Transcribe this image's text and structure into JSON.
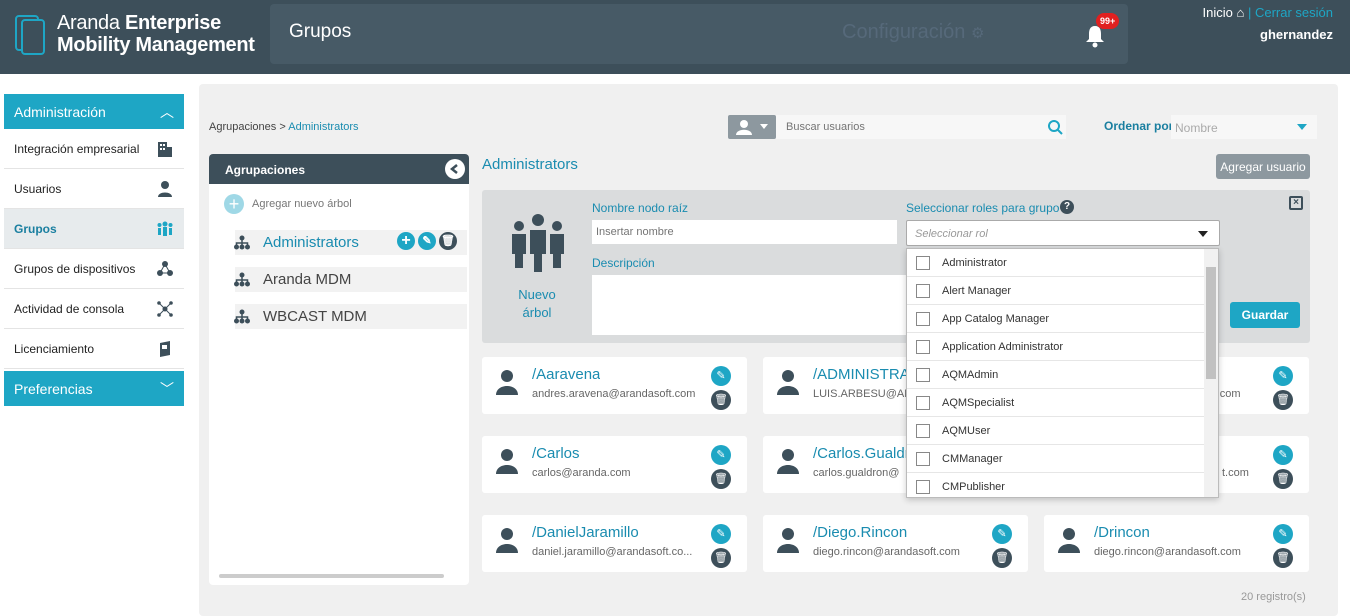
{
  "header": {
    "brand_line1_light": "Aranda",
    "brand_line1_bold": "Enterprise",
    "brand_line2": "Mobility Management",
    "page_title": "Grupos",
    "config_label": "Configuración",
    "notification_badge": "99+",
    "home_link": "Inicio",
    "separator": "|",
    "logout_link": "Cerrar sesión",
    "username": "ghernandez"
  },
  "sidebar": {
    "sections": [
      {
        "label": "Administración",
        "expanded": true
      },
      {
        "label": "Preferencias",
        "expanded": false
      }
    ],
    "items": [
      {
        "label": "Integración empresarial",
        "icon": "building-icon"
      },
      {
        "label": "Usuarios",
        "icon": "user-icon"
      },
      {
        "label": "Grupos",
        "icon": "group-icon",
        "active": true
      },
      {
        "label": "Grupos de dispositivos",
        "icon": "device-group-icon"
      },
      {
        "label": "Actividad de consola",
        "icon": "network-icon"
      },
      {
        "label": "Licenciamiento",
        "icon": "license-icon"
      }
    ]
  },
  "breadcrumb": {
    "root": "Agrupaciones",
    "sep": ">",
    "current": "Administrators"
  },
  "search": {
    "placeholder": "Buscar usuarios"
  },
  "order": {
    "label": "Ordenar por:",
    "value": "Nombre"
  },
  "tree": {
    "header": "Agrupaciones",
    "add_label": "Agregar nuevo árbol",
    "nodes": [
      "Administrators",
      "Aranda MDM",
      "WBCAST MDM"
    ]
  },
  "group": {
    "title": "Administrators",
    "add_user_label": "Agregar usuario"
  },
  "form": {
    "new_label": "Nuevo árbol",
    "name_label": "Nombre nodo raíz",
    "name_placeholder": "Insertar nombre",
    "desc_label": "Descripción",
    "roles_label": "Seleccionar roles para grupo",
    "roles_placeholder": "Seleccionar rol",
    "help": "?",
    "save_label": "Guardar"
  },
  "roles": [
    "Administrator",
    "Alert Manager",
    "App Catalog Manager",
    "Application Administrator",
    "AQMAdmin",
    "AQMSpecialist",
    "AQMUser",
    "CMManager",
    "CMPublisher"
  ],
  "users": [
    {
      "name": "/Aaravena",
      "email": "andres.aravena@arandasoft.com"
    },
    {
      "name": "/ADMINISTRA",
      "email": "LUIS.ARBESU@AR"
    },
    {
      "name": "",
      "email": "soft.com"
    },
    {
      "name": "/Carlos",
      "email": "carlos@aranda.com"
    },
    {
      "name": "/Carlos.Gualdr",
      "email": "carlos.gualdron@"
    },
    {
      "name": "",
      "email": "t.com"
    },
    {
      "name": "/DanielJaramillo",
      "email": "daniel.jaramillo@arandasoft.co..."
    },
    {
      "name": "/Diego.Rincon",
      "email": "diego.rincon@arandasoft.com"
    },
    {
      "name": "/Drincon",
      "email": "diego.rincon@arandasoft.com"
    }
  ],
  "records": "20 registro(s)",
  "colors": {
    "accent": "#1ea6c5",
    "header": "#3d4f5a",
    "link": "#1a8cb0"
  }
}
